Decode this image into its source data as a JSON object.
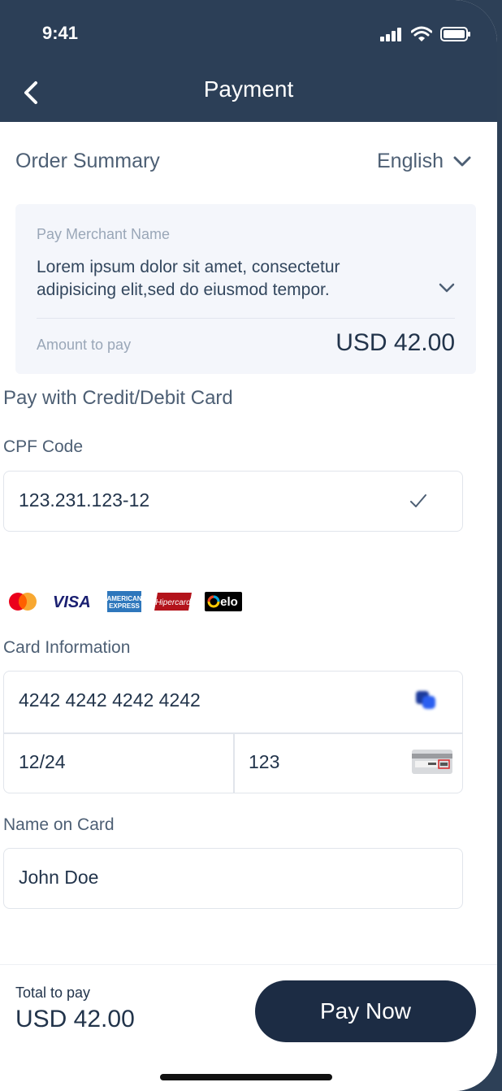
{
  "status": {
    "time": "9:41"
  },
  "header": {
    "title": "Payment"
  },
  "order": {
    "title": "Order Summary",
    "language": "English",
    "merchant_label": "Pay Merchant Name",
    "description": "Lorem ipsum dolor sit amet, consectetur adipisicing elit,sed do eiusmod tempor.",
    "amount_label": "Amount to pay",
    "amount_value": "USD 42.00"
  },
  "payment": {
    "section_title": "Pay with Credit/Debit Card",
    "cpf_label": "CPF Code",
    "cpf_value": "123.231.123-12",
    "card_brands": [
      "mastercard",
      "visa",
      "american-express",
      "hipercard",
      "elo"
    ],
    "card_info_label": "Card Information",
    "card_number": "4242 4242 4242 4242",
    "card_expiry": "12/24",
    "card_cvc": "123",
    "name_label": "Name on Card",
    "name_value": "John Doe"
  },
  "footer": {
    "total_label": "Total to pay",
    "total_value": "USD 42.00",
    "pay_button": "Pay Now"
  },
  "brand_text": {
    "visa": "VISA",
    "amex_line1": "AMERICAN",
    "amex_line2": "EXPRESS",
    "hipercard": "Hipercard",
    "elo": "elo"
  },
  "colors": {
    "header_bg": "#2c3f57",
    "primary_button": "#1c2c44",
    "text_primary": "#22344b",
    "text_muted": "#9aa7b8"
  }
}
